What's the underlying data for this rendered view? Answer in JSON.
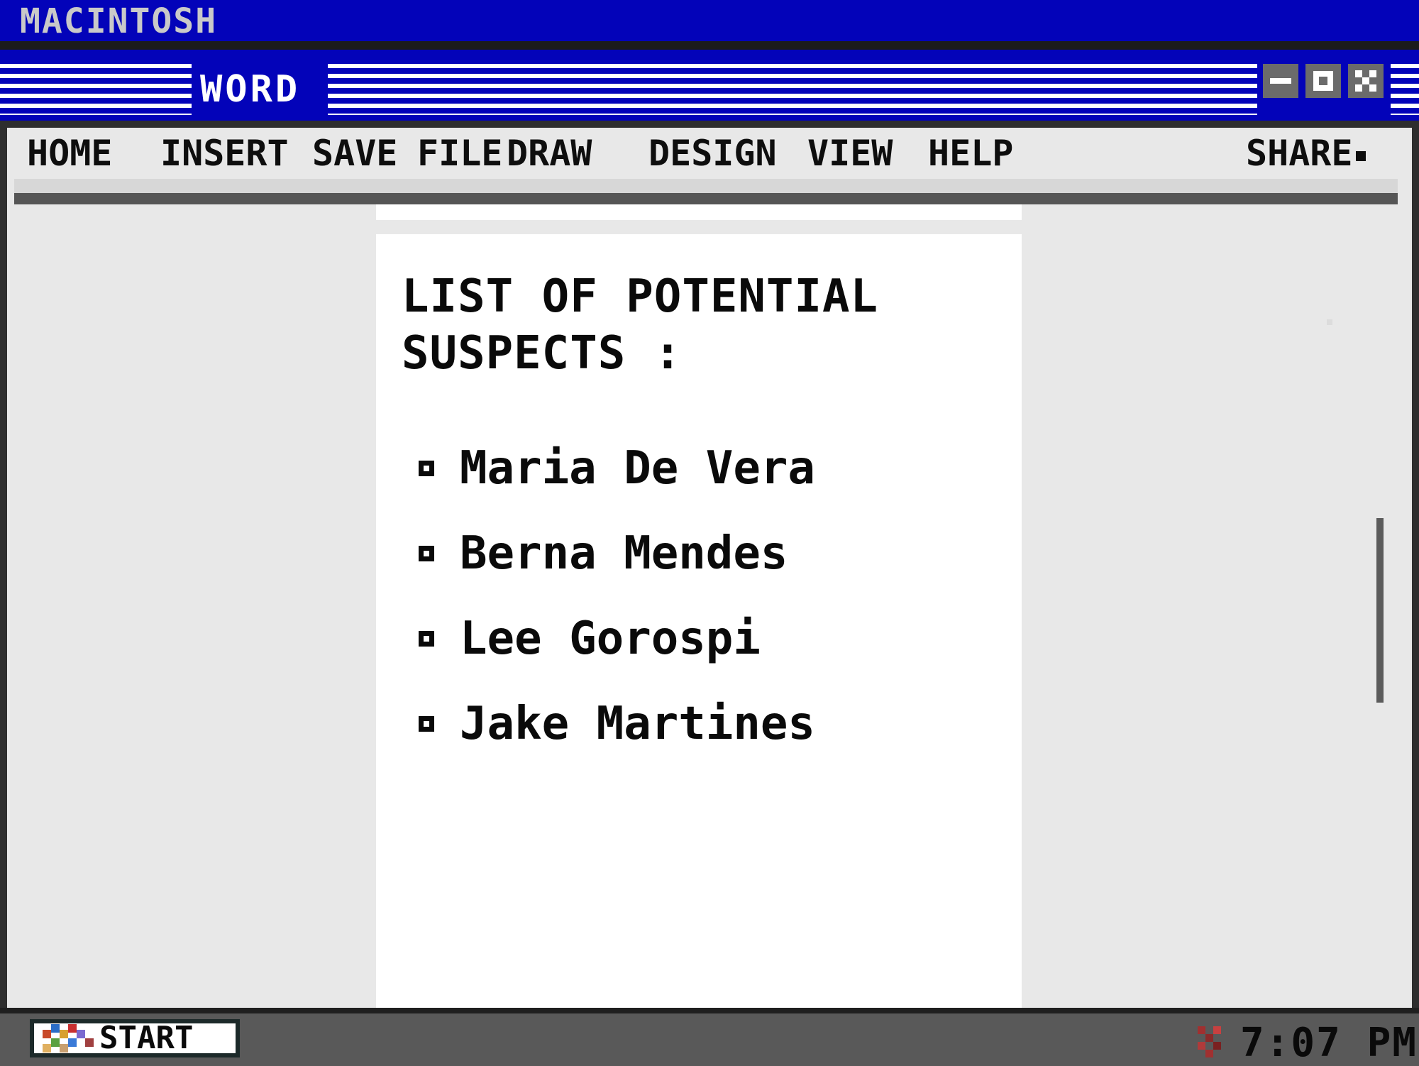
{
  "system": {
    "title": "MACINTOSH"
  },
  "window": {
    "title": "WORD",
    "controls": [
      {
        "name": "minimize-button",
        "icon": "minimize-icon"
      },
      {
        "name": "restore-button",
        "icon": "restore-icon"
      },
      {
        "name": "close-button",
        "icon": "close-icon"
      }
    ]
  },
  "menu": {
    "items": [
      "HOME",
      "INSERT",
      "SAVE",
      "FILE",
      "DRAW",
      "DESIGN",
      "VIEW",
      "HELP"
    ],
    "share": "SHARE"
  },
  "document": {
    "heading_line1": "LIST OF POTENTIAL",
    "heading_line2": "SUSPECTS :",
    "suspects": [
      "Maria De Vera",
      "Berna Mendes",
      "Lee Gorospi",
      "Jake Martines"
    ]
  },
  "taskbar": {
    "start_label": "START",
    "clock": "7:07 PM"
  },
  "colors": {
    "title_blue": "#0303b9",
    "menu_bg": "#e8e8e8",
    "taskbar": "#595959"
  }
}
